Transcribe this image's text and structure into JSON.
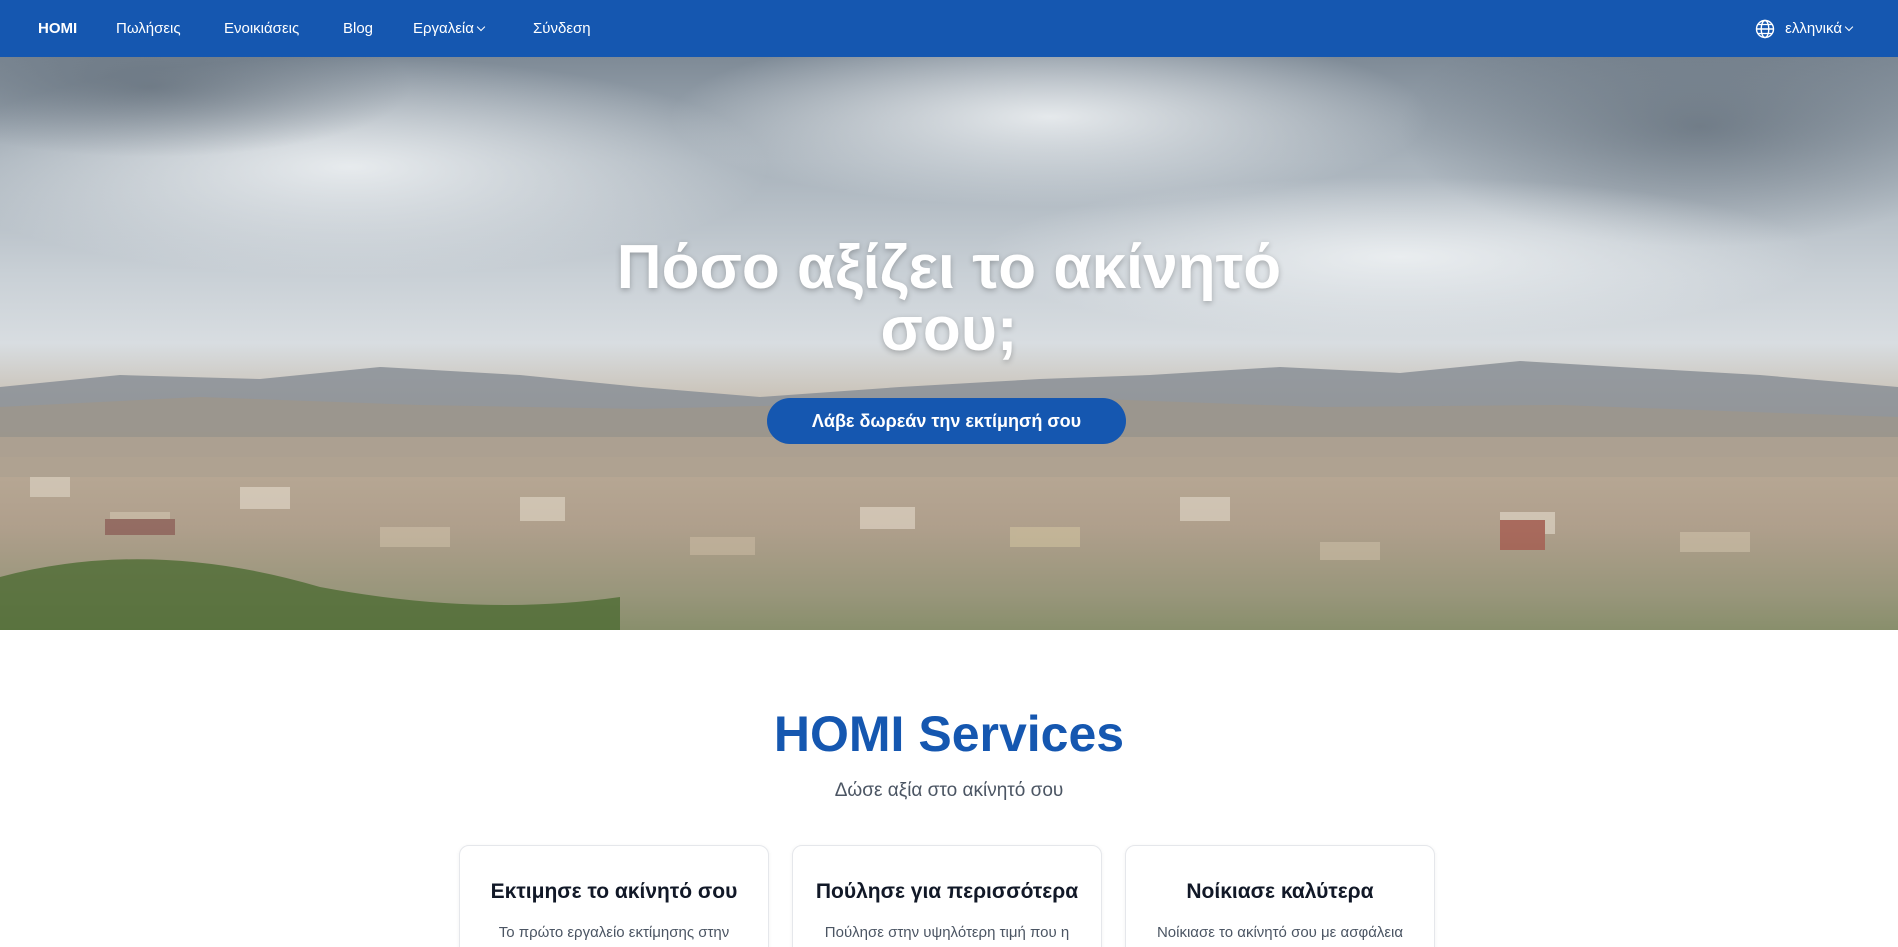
{
  "nav": {
    "brand": "HOMI",
    "items": [
      "Πωλήσεις",
      "Ενοικιάσεις",
      "Blog",
      "Εργαλεία",
      "Σύνδεση"
    ],
    "language": "ελληνικά",
    "language_icon": "globe-icon",
    "bg_color": "#1557b0"
  },
  "hero": {
    "title_line1": "Πόσο αξίζει το ακίνητό",
    "title_line2": "σου;",
    "cta": "Λάβε δωρεάν την εκτίμησή σου"
  },
  "services": {
    "title": "HOMI Services",
    "subtitle": "Δώσε αξία στο ακίνητό σου",
    "cards": [
      {
        "title": "Εκτιμησε το ακίνητό σου",
        "text": "Το πρώτο εργαλείο εκτίμησης στην"
      },
      {
        "title": "Πούλησε για περισσότερα",
        "text": "Πούλησε στην υψηλότερη τιμή που η"
      },
      {
        "title": "Νοίκιασε καλύτερα",
        "text": "Νοίκιασε το ακίνητό σου με ασφάλεια"
      }
    ]
  },
  "colors": {
    "accent": "#1557b0"
  }
}
